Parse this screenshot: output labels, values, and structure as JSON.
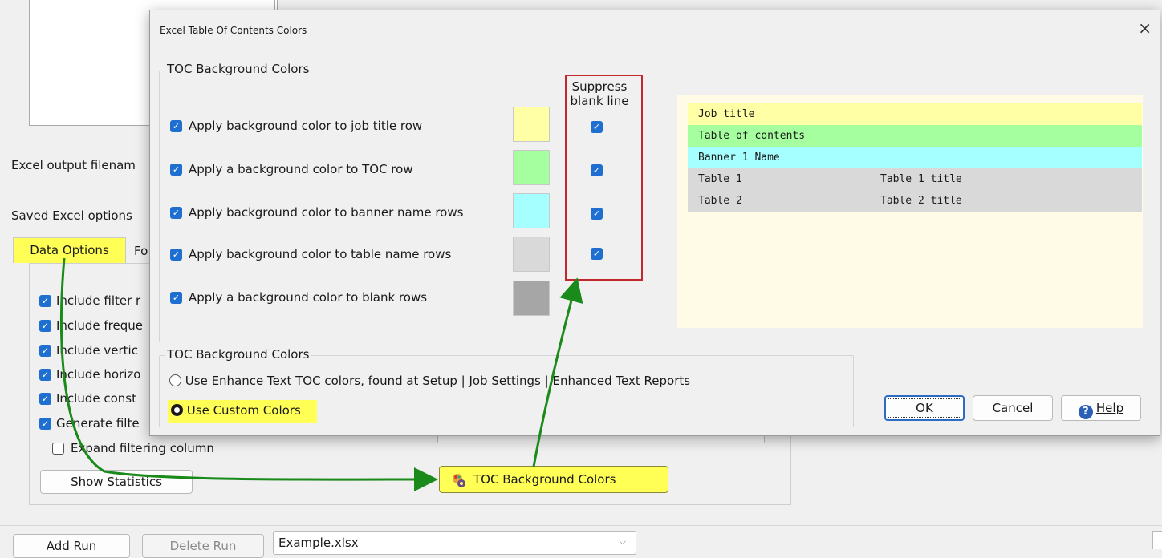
{
  "background": {
    "labels": {
      "output_filename": "Excel output filenam",
      "saved_options": "Saved Excel options"
    },
    "tabs": [
      {
        "label": "Data Options",
        "active": true
      },
      {
        "label": "Fo"
      }
    ],
    "options": [
      {
        "label": "Include filter r",
        "checked": true
      },
      {
        "label": "Include freque",
        "checked": true
      },
      {
        "label": "Include vertic",
        "checked": true
      },
      {
        "label": "Include horizo",
        "checked": true
      },
      {
        "label": "Include const",
        "checked": true
      },
      {
        "label": "Generate filte",
        "checked": true
      },
      {
        "label": "Expand filtering column",
        "checked": false
      }
    ],
    "show_statistics_label": "Show Statistics",
    "toc_button_label": "TOC Background Colors",
    "bottom": {
      "add_run": "Add Run",
      "delete_run": "Delete Run",
      "file_select": "Example.xlsx"
    }
  },
  "dialog": {
    "title": "Excel Table Of Contents Colors",
    "close_symbol": "×",
    "group1_title": "TOC Background Colors",
    "suppress_header": [
      "Suppress",
      "blank line"
    ],
    "rows": [
      {
        "label": "Apply background color to job title row",
        "checked": true,
        "color": "#ffffa6",
        "suppress": true
      },
      {
        "label": "Apply a background color to TOC row",
        "checked": true,
        "color": "#a6ff9e",
        "suppress": true
      },
      {
        "label": "Apply background color to banner name rows",
        "checked": true,
        "color": "#a6ffff",
        "suppress": true
      },
      {
        "label": "Apply background color to table name rows",
        "checked": true,
        "color": "#d9d9d9",
        "suppress": true
      },
      {
        "label": "Apply a background color to blank rows",
        "checked": true,
        "color": "#a6a6a6"
      }
    ],
    "group2_title": "TOC Background Colors",
    "radios": [
      {
        "label": "Use Enhance Text TOC colors, found at Setup | Job Settings | Enhanced Text Reports",
        "selected": false
      },
      {
        "label": "Use Custom Colors",
        "selected": true
      }
    ],
    "preview": {
      "background": "#fffbe6",
      "rows": [
        {
          "c1": "Job title",
          "c2": "",
          "color": "#ffffa6"
        },
        {
          "c1": "Table of contents",
          "c2": "",
          "color": "#a6ff9e"
        },
        {
          "c1": "Banner 1 Name",
          "c2": "",
          "color": "#a6ffff"
        },
        {
          "c1": "Table 1",
          "c2": "Table 1 title",
          "color": "#d9d9d9"
        },
        {
          "c1": "Table 2",
          "c2": "Table 2 title",
          "color": "#d9d9d9"
        }
      ]
    },
    "buttons": {
      "ok": "OK",
      "cancel": "Cancel",
      "help": "Help"
    }
  },
  "colors": {
    "highlight": "#ffff55",
    "arrow": "#1a8a1a",
    "suppress_box": "#c0282d",
    "checkbox": "#1f6fd1"
  }
}
